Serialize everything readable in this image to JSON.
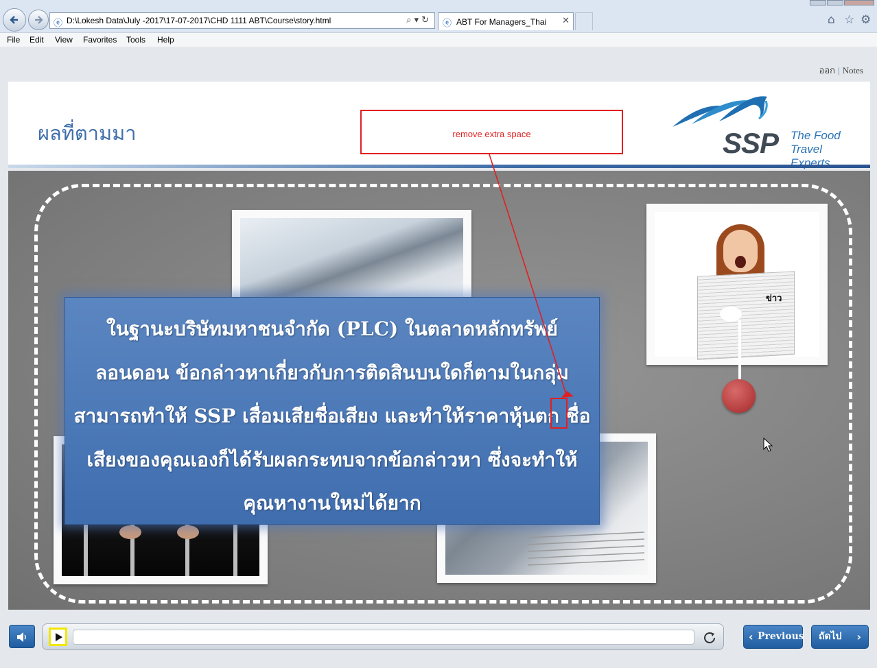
{
  "browser": {
    "address_url": "D:\\Lokesh Data\\July -2017\\17-07-2017\\CHD 1111 ABT\\Course\\story.html",
    "tab_title": "ABT For Managers_Thai",
    "menu": [
      "File",
      "Edit",
      "View",
      "Favorites",
      "Tools",
      "Help"
    ]
  },
  "player_links": {
    "exit": "ออก",
    "notes": "Notes"
  },
  "slide": {
    "title": "ผลที่ตามมา",
    "body_text": "ในฐานะบริษัทมหาชนจำกัด (PLC) ในตลาดหลักทรัพย์ลอนดอน ข้อกล่าวหาเกี่ยวกับการติดสินบนใดก็ตามในกลุ่มสามารถทำให้ SSP เสื่อมเสียชื่อเสียง และทำให้ราคาหุ้นตก ชื่อเสียงของคุณเองก็ได้รับผลกระทบจากข้อกล่าวหา ซึ่งจะทำให้คุณหางานใหม่ได้ยาก",
    "newspaper_word": "ข่าว"
  },
  "logo": {
    "brand": "SSP",
    "tagline_line1": "The Food",
    "tagline_line2": "Travel Experts",
    "brand_color": "#3f4a55",
    "accent_color": "#2b73b6"
  },
  "review_comment": "remove extra space",
  "controls": {
    "previous": "Previous",
    "next": "ถัดไป"
  },
  "colors": {
    "title": "#3f6fab",
    "textbox": "#4a77b6",
    "comment": "#e02020",
    "button": "#2b6ab0"
  }
}
